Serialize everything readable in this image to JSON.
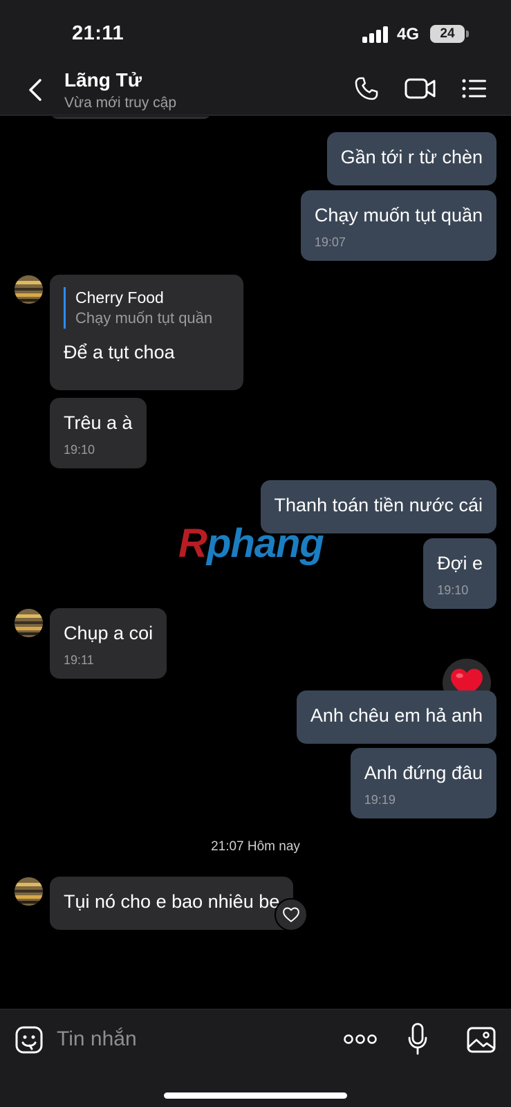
{
  "status_bar": {
    "time": "21:11",
    "network": "4G",
    "battery": "24"
  },
  "header": {
    "contact_name": "Lãng Tử",
    "contact_status": "Vừa mới truy cập"
  },
  "messages": [
    {
      "direction": "out",
      "text": "Gần tới r từ chèn"
    },
    {
      "direction": "out",
      "text": "Chạy muốn tụt quần",
      "time": "19:07"
    },
    {
      "direction": "in",
      "quote_name": "Cherry Food",
      "quote_text": "Chạy muốn tụt quần",
      "text": "Để a tụt choa"
    },
    {
      "direction": "in",
      "text": "Trêu a à",
      "time": "19:10"
    },
    {
      "direction": "out",
      "text": "Thanh toán tiền nước cái"
    },
    {
      "direction": "out",
      "text": "Đợi e",
      "time": "19:10"
    },
    {
      "direction": "in",
      "text": "Chụp a coi",
      "time": "19:11"
    },
    {
      "direction": "out",
      "text": "Anh chêu em hả anh"
    },
    {
      "direction": "out",
      "text": "Anh đứng đâu",
      "time": "19:19"
    },
    {
      "direction": "in",
      "text": "Tụi nó cho e bao nhiêu be"
    }
  ],
  "date_separator": "21:07 Hôm nay",
  "reaction": "heart-icon",
  "watermark": {
    "part1": "R",
    "part2": "phang"
  },
  "input": {
    "placeholder": "Tin nhắn"
  },
  "icons": [
    "back-icon",
    "phone-icon",
    "video-icon",
    "menu-icon",
    "sticker-icon",
    "more-icon",
    "mic-icon",
    "image-icon",
    "like-heart-icon"
  ],
  "colors": {
    "outgoing_bubble": "#3a4656",
    "incoming_bubble": "#2c2c2e",
    "accent": "#2e8bff"
  }
}
